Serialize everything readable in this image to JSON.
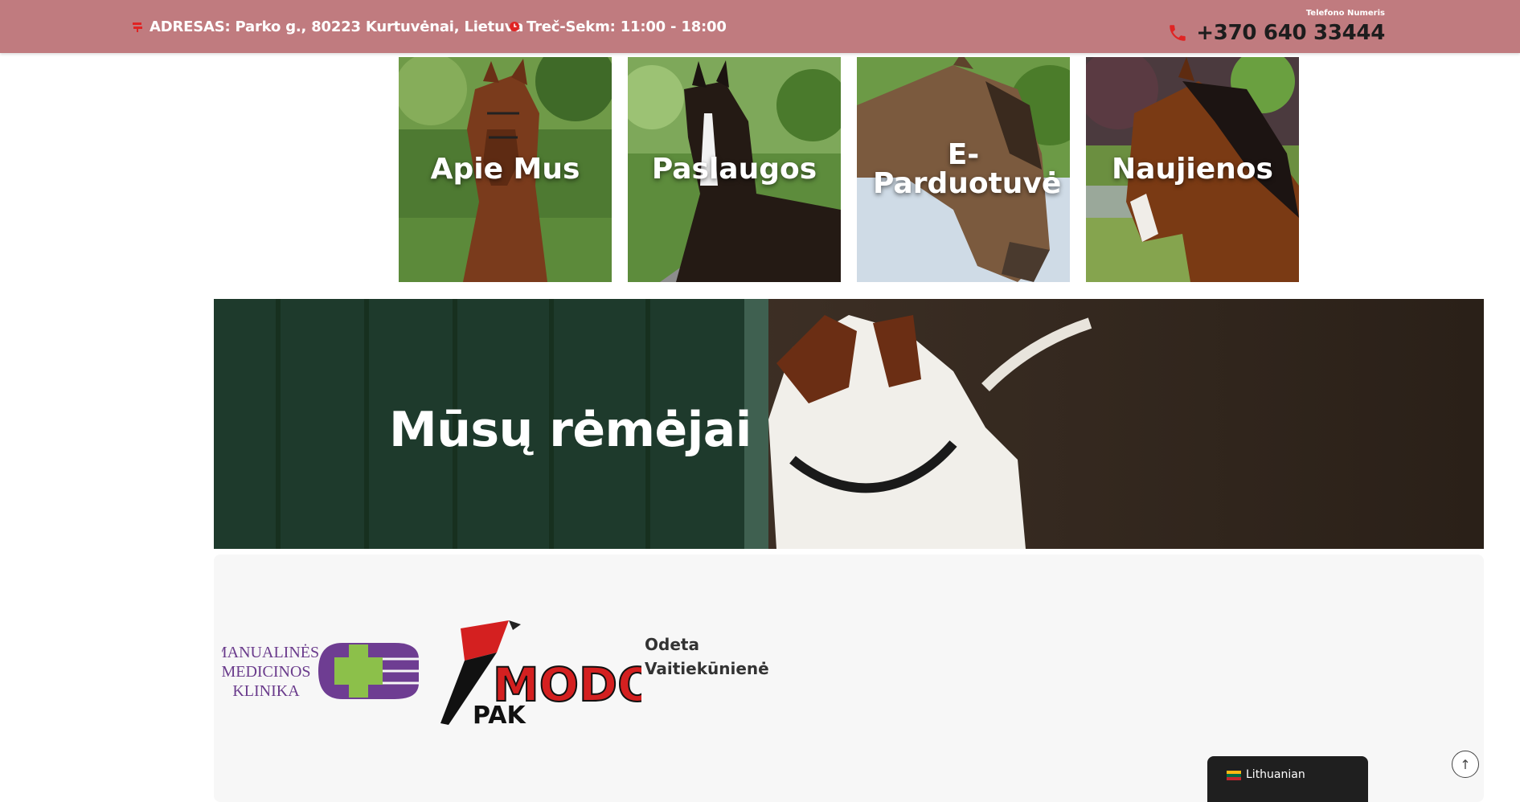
{
  "topbar": {
    "address": "ADRESAS: Parko g., 80223 Kurtuvėnai, Lietuva",
    "hours": "Treč-Sekm: 11:00 - 18:00",
    "phone_label": "Telefono Numeris",
    "phone": "+370 640 33444",
    "accent": "#e02424",
    "bg": "#c07b7f"
  },
  "tiles": [
    {
      "label": "Apie Mus"
    },
    {
      "label": "Paslaugos"
    },
    {
      "label": "E-Parduotuvė"
    },
    {
      "label": "Naujienos"
    }
  ],
  "banner": {
    "title": "Mūsų rėmėjai"
  },
  "sponsors": {
    "logo1_lines": [
      "MANUALINĖS",
      "MEDICINOS",
      "KLINIKA"
    ],
    "logo2_word": "MODO",
    "logo2_sub": "PAK",
    "person_first": "Odeta",
    "person_last": "Vaitiekūnienė"
  },
  "language": {
    "label": "Lithuanian"
  },
  "icons": {
    "address": "sign-icon",
    "hours": "clock-icon",
    "phone": "phone-icon",
    "back_to_top": "arrow-up-icon"
  }
}
